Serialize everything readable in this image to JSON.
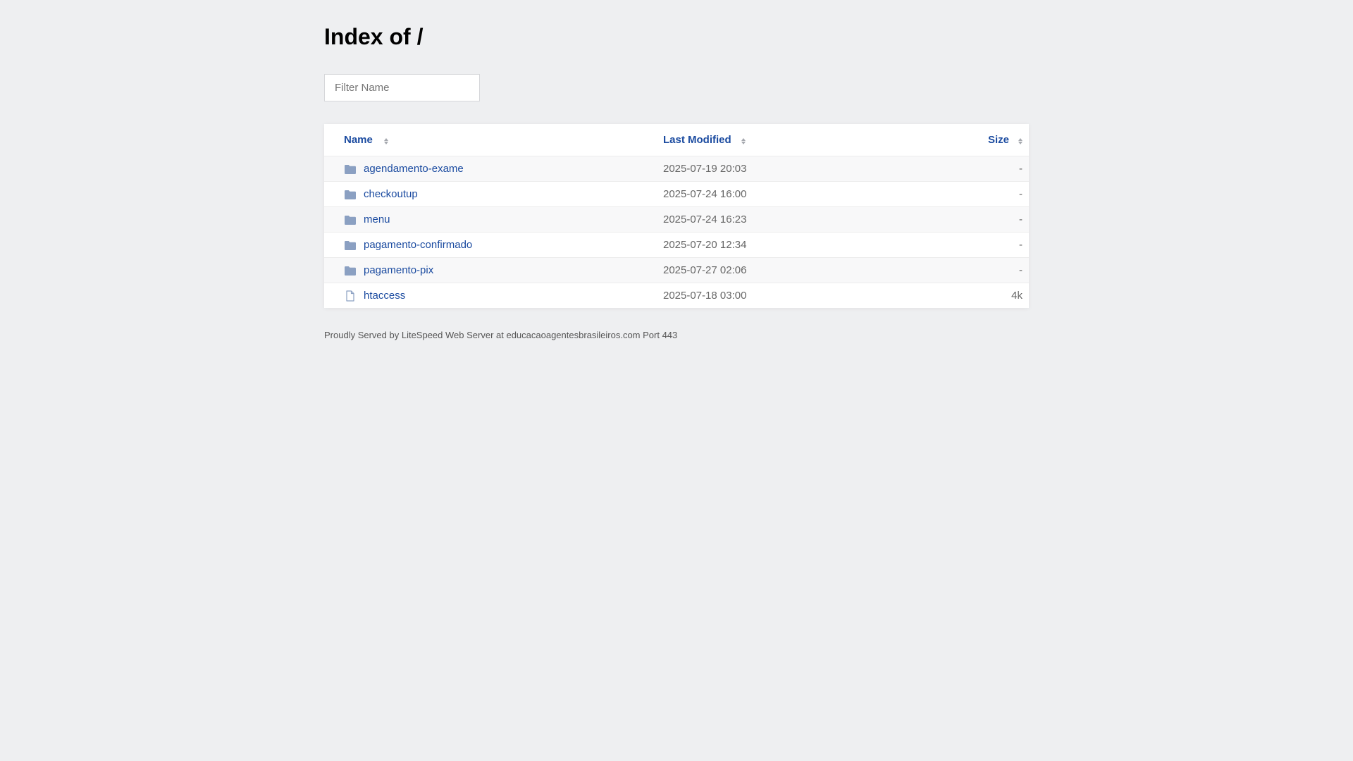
{
  "page": {
    "title": "Index of /",
    "filter_placeholder": "Filter Name",
    "footer": "Proudly Served by LiteSpeed Web Server at educacaoagentesbrasileiros.com Port 443"
  },
  "table": {
    "headers": {
      "name": "Name",
      "last_modified": "Last Modified",
      "size": "Size"
    },
    "rows": [
      {
        "name": "agendamento-exame",
        "modified": "2025-07-19 20:03",
        "size": "-",
        "icon": "folder-icon"
      },
      {
        "name": "checkoutup",
        "modified": "2025-07-24 16:00",
        "size": "-",
        "icon": "folder-icon"
      },
      {
        "name": "menu",
        "modified": "2025-07-24 16:23",
        "size": "-",
        "icon": "folder-icon"
      },
      {
        "name": "pagamento-confirmado",
        "modified": "2025-07-20 12:34",
        "size": "-",
        "icon": "folder-icon"
      },
      {
        "name": "pagamento-pix",
        "modified": "2025-07-27 02:06",
        "size": "-",
        "icon": "folder-icon"
      },
      {
        "name": "htaccess",
        "modified": "2025-07-18 03:00",
        "size": "4k",
        "icon": "file-icon"
      }
    ]
  },
  "colors": {
    "background": "#eeeff1",
    "link": "#1b4ba0",
    "folder_icon": "#8ba0c2"
  }
}
